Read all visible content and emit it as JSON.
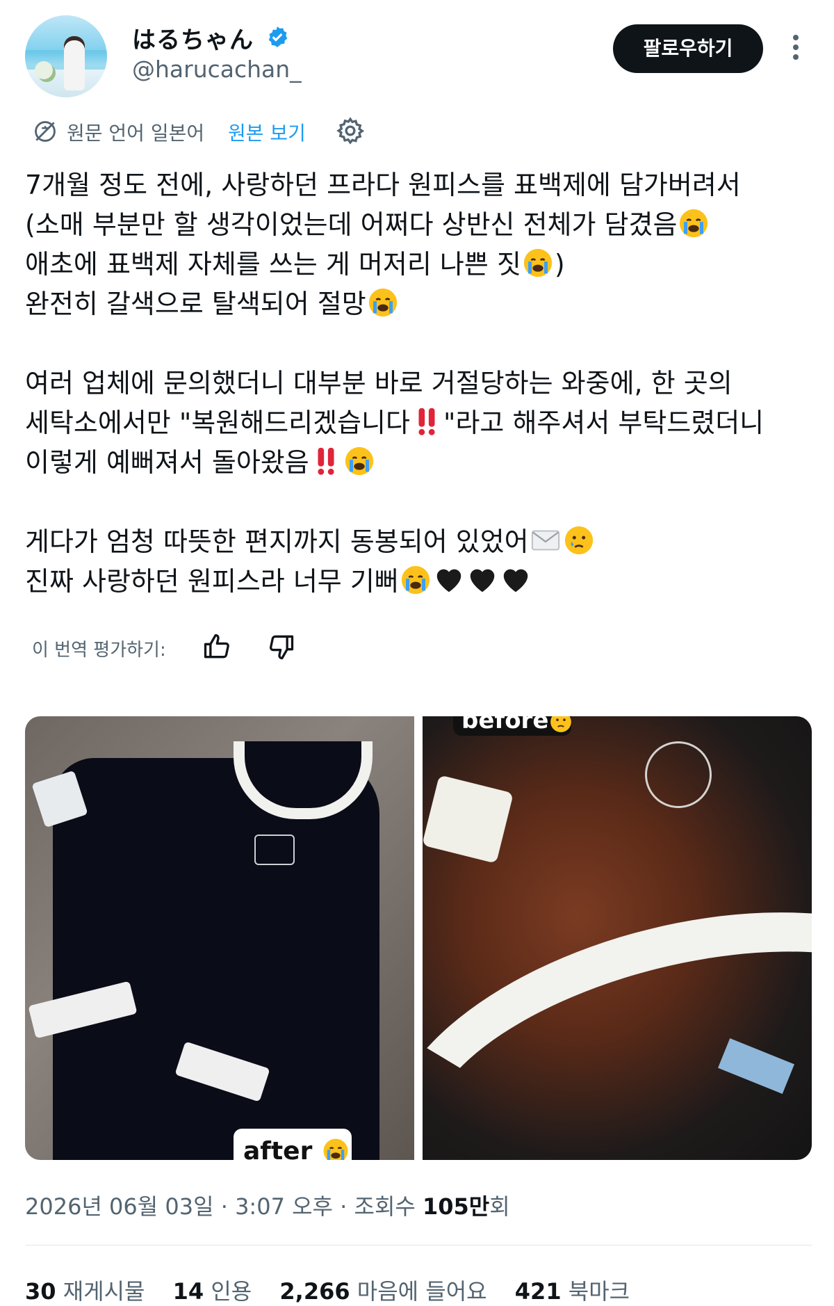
{
  "colors": {
    "link": "#1d9bf0",
    "muted": "#536471",
    "verified": "#1d9bf0",
    "follow_bg": "#0f1419"
  },
  "author": {
    "display_name": "はるちゃん",
    "handle": "@harucachan_",
    "verified_icon": "verified-badge-icon"
  },
  "follow_button": "팔로우하기",
  "more_icon": "more-vertical-icon",
  "translation": {
    "source_label": "원문 언어 일본어",
    "show_original": "원본 보기",
    "settings_icon": "gear-icon",
    "globe_icon": "translate-icon"
  },
  "body": {
    "l1": "7개월 정도 전에, 사랑하던 프라다 원피스를 표백제에 담가버려서",
    "l2": "(소매 부분만 할 생각이었는데 어쩌다 상반신 전체가 담겼음",
    "l3": "애초에 표백제 자체를 쓰는 게 머저리 나쁜 짓",
    "l3_tail": ")",
    "l4": "완전히 갈색으로 탈색되어 절망",
    "l5": "여러 업체에 문의했더니 대부분 바로 거절당하는 와중에, 한 곳의",
    "l6a": "세탁소에서만 \"복원해드리겠습니다",
    "l6b": "\"라고 해주셔서 부탁드렸더니",
    "l7": "이렇게 예뻐져서 돌아왔음",
    "l8": "게다가 엄청 따뜻한 편지까지 동봉되어 있었어",
    "l9": "진짜 사랑하던 원피스라 너무 기뻐"
  },
  "rate": {
    "label": "이 번역 평가하기:",
    "up_icon": "thumbs-up-icon",
    "down_icon": "thumbs-down-icon"
  },
  "media": {
    "after_label": "after",
    "before_label": "before"
  },
  "meta": {
    "date": "2026년 06월 03일",
    "sep1": " · ",
    "time": "3:07 오후",
    "sep2": " · ",
    "views_label": "조회수 ",
    "views_num": "105만",
    "views_suffix": "회"
  },
  "stats": [
    {
      "num": "30",
      "label": "재게시물"
    },
    {
      "num": "14",
      "label": "인용"
    },
    {
      "num": "2,266",
      "label": "마음에 들어요"
    },
    {
      "num": "421",
      "label": "북마크"
    }
  ]
}
